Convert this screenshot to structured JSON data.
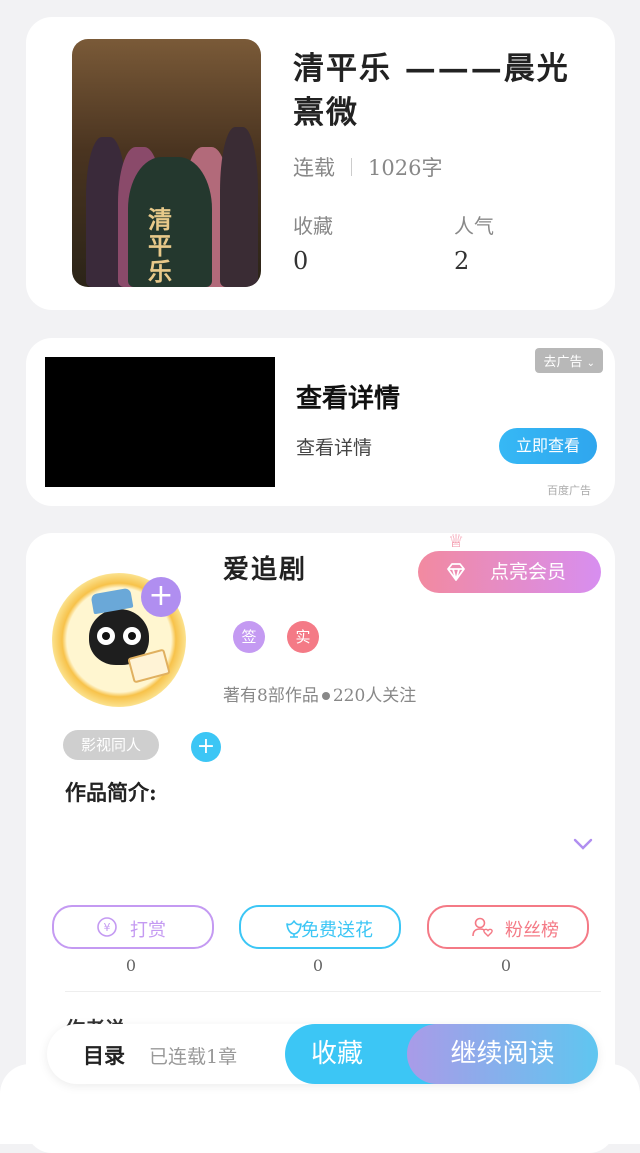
{
  "book": {
    "title": "清平乐 ———晨光熹微",
    "status": "连载",
    "word_count": "1026字",
    "stats": [
      {
        "label": "收藏",
        "value": "0"
      },
      {
        "label": "人气",
        "value": "2"
      }
    ],
    "cover_text": "清平乐"
  },
  "ad": {
    "close_label": "去广告",
    "title": "查看详情",
    "subtitle": "查看详情",
    "button_label": "立即查看",
    "source": "百度广告"
  },
  "author": {
    "name": "爱追剧",
    "vip_button": "点亮会员",
    "badges": [
      {
        "label": "签",
        "color": "#c49af2"
      },
      {
        "label": "实",
        "color": "#f47a86"
      }
    ],
    "works_text": "著有8部作品",
    "followers_text": "220人关注",
    "tag": "影视同人",
    "follow_plus": "+",
    "tag_add": "+"
  },
  "intro": {
    "label": "作品简介:"
  },
  "actions": [
    {
      "label": "打赏",
      "count": "0",
      "icon": "yen-coin-icon",
      "color": "#c49af2"
    },
    {
      "label": "免费送花",
      "count": "0",
      "icon": "flower-icon",
      "color": "#3cc6f5"
    },
    {
      "label": "粉丝榜",
      "count": "0",
      "icon": "fan-ranking-icon",
      "color": "#f47a86"
    }
  ],
  "peek_text": "作者说",
  "bottom_bar": {
    "toc_label": "目录",
    "chapter_status": "已连载1章",
    "favorite_label": "收藏",
    "read_label": "继续阅读"
  },
  "colors": {
    "accent_blue": "#3cc6f5",
    "accent_purple": "#c49af2",
    "accent_pink": "#f47a86"
  }
}
